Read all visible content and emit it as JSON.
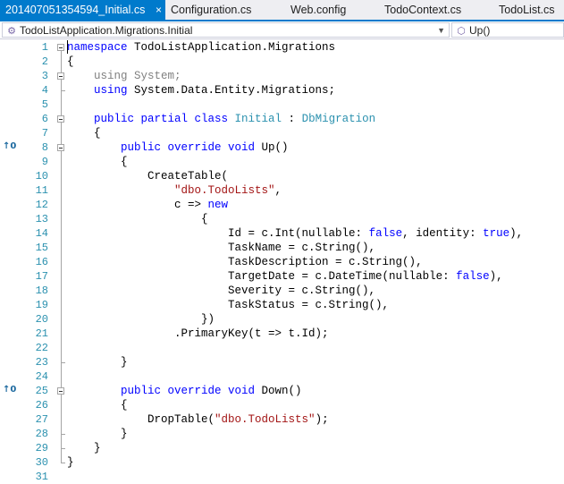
{
  "tabs": [
    {
      "label": "201407051354594_Initial.cs",
      "active": true
    },
    {
      "label": "Configuration.cs"
    },
    {
      "label": "Web.config"
    },
    {
      "label": "TodoContext.cs"
    },
    {
      "label": "TodoList.cs"
    }
  ],
  "close_glyph": "×",
  "nav": {
    "left": "TodoListApplication.Migrations.Initial",
    "right": "Up()"
  },
  "bookmark_glyph": "↑0",
  "lines": [
    {
      "n": "1",
      "tokens": [
        [
          "k",
          "namespace"
        ],
        [
          "p",
          " TodoListApplication.Migrations"
        ]
      ]
    },
    {
      "n": "2",
      "tokens": [
        [
          "p",
          "{"
        ]
      ]
    },
    {
      "n": "3",
      "tokens": [
        [
          "g",
          "    using System;"
        ]
      ]
    },
    {
      "n": "4",
      "tokens": [
        [
          "k",
          "    using"
        ],
        [
          "p",
          " System.Data.Entity.Migrations;"
        ]
      ]
    },
    {
      "n": "5",
      "tokens": []
    },
    {
      "n": "6",
      "tokens": [
        [
          "k",
          "    public partial class "
        ],
        [
          "t",
          "Initial"
        ],
        [
          "p",
          " : "
        ],
        [
          "t",
          "DbMigration"
        ]
      ]
    },
    {
      "n": "7",
      "tokens": [
        [
          "p",
          "    {"
        ]
      ]
    },
    {
      "n": "8",
      "tokens": [
        [
          "k",
          "        public override void"
        ],
        [
          "p",
          " Up()"
        ]
      ],
      "bookmark": true
    },
    {
      "n": "9",
      "tokens": [
        [
          "p",
          "        {"
        ]
      ]
    },
    {
      "n": "10",
      "tokens": [
        [
          "p",
          "            CreateTable("
        ]
      ]
    },
    {
      "n": "11",
      "tokens": [
        [
          "s",
          "                \"dbo.TodoLists\""
        ],
        [
          "p",
          ","
        ]
      ]
    },
    {
      "n": "12",
      "tokens": [
        [
          "p",
          "                c => "
        ],
        [
          "k",
          "new"
        ]
      ]
    },
    {
      "n": "13",
      "tokens": [
        [
          "p",
          "                    {"
        ]
      ]
    },
    {
      "n": "14",
      "tokens": [
        [
          "p",
          "                        Id = c.Int(nullable: "
        ],
        [
          "k",
          "false"
        ],
        [
          "p",
          ", identity: "
        ],
        [
          "k",
          "true"
        ],
        [
          "p",
          "),"
        ]
      ]
    },
    {
      "n": "15",
      "tokens": [
        [
          "p",
          "                        TaskName = c.String(),"
        ]
      ]
    },
    {
      "n": "16",
      "tokens": [
        [
          "p",
          "                        TaskDescription = c.String(),"
        ]
      ]
    },
    {
      "n": "17",
      "tokens": [
        [
          "p",
          "                        TargetDate = c.DateTime(nullable: "
        ],
        [
          "k",
          "false"
        ],
        [
          "p",
          "),"
        ]
      ]
    },
    {
      "n": "18",
      "tokens": [
        [
          "p",
          "                        Severity = c.String(),"
        ]
      ]
    },
    {
      "n": "19",
      "tokens": [
        [
          "p",
          "                        TaskStatus = c.String(),"
        ]
      ]
    },
    {
      "n": "20",
      "tokens": [
        [
          "p",
          "                    })"
        ]
      ]
    },
    {
      "n": "21",
      "tokens": [
        [
          "p",
          "                .PrimaryKey(t => t.Id);"
        ]
      ]
    },
    {
      "n": "22",
      "tokens": []
    },
    {
      "n": "23",
      "tokens": [
        [
          "p",
          "        }"
        ]
      ]
    },
    {
      "n": "24",
      "tokens": []
    },
    {
      "n": "25",
      "tokens": [
        [
          "k",
          "        public override void"
        ],
        [
          "p",
          " Down()"
        ]
      ],
      "bookmark": true
    },
    {
      "n": "26",
      "tokens": [
        [
          "p",
          "        {"
        ]
      ]
    },
    {
      "n": "27",
      "tokens": [
        [
          "p",
          "            DropTable("
        ],
        [
          "s",
          "\"dbo.TodoLists\""
        ],
        [
          "p",
          ");"
        ]
      ]
    },
    {
      "n": "28",
      "tokens": [
        [
          "p",
          "        }"
        ]
      ]
    },
    {
      "n": "29",
      "tokens": [
        [
          "p",
          "    }"
        ]
      ]
    },
    {
      "n": "30",
      "tokens": [
        [
          "p",
          "}"
        ]
      ]
    },
    {
      "n": "31",
      "tokens": []
    }
  ],
  "colors": {
    "keyword": "#0000ff",
    "type": "#2b91af",
    "string": "#a31515",
    "grayed": "#808080",
    "accent": "#007acc",
    "change_bar": "#57a64a"
  }
}
